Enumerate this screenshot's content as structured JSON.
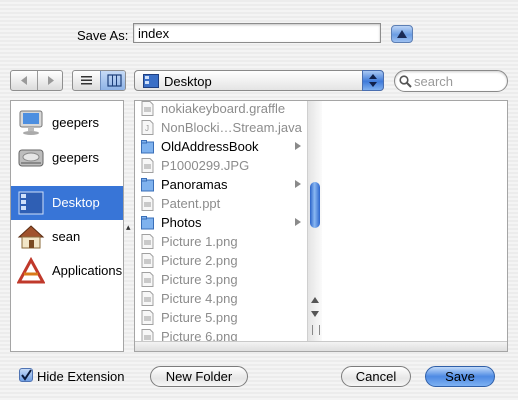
{
  "save_as": {
    "label": "Save As:",
    "filename": "index"
  },
  "toolbar": {
    "location": "Desktop",
    "search_placeholder": "search"
  },
  "sidebar": {
    "items": [
      {
        "label": "geepers",
        "icon": "computer-icon"
      },
      {
        "label": "geepers",
        "icon": "hard-drive-icon"
      },
      {
        "label": "Desktop",
        "icon": "desktop-icon",
        "selected": true
      },
      {
        "label": "sean",
        "icon": "home-icon"
      },
      {
        "label": "Applications",
        "icon": "applications-icon"
      }
    ]
  },
  "browser": {
    "column1": [
      {
        "name": "nokiakeyboard.graffle",
        "kind": "file",
        "enabled": false
      },
      {
        "name": "NonBlocki…Stream.java",
        "kind": "java-file",
        "enabled": false
      },
      {
        "name": "OldAddressBook",
        "kind": "folder",
        "enabled": true
      },
      {
        "name": "P1000299.JPG",
        "kind": "file",
        "enabled": false
      },
      {
        "name": "Panoramas",
        "kind": "folder",
        "enabled": true
      },
      {
        "name": "Patent.ppt",
        "kind": "file",
        "enabled": false
      },
      {
        "name": "Photos",
        "kind": "folder",
        "enabled": true
      },
      {
        "name": "Picture 1.png",
        "kind": "file",
        "enabled": false
      },
      {
        "name": "Picture 2.png",
        "kind": "file",
        "enabled": false
      },
      {
        "name": "Picture 3.png",
        "kind": "file",
        "enabled": false
      },
      {
        "name": "Picture 4.png",
        "kind": "file",
        "enabled": false
      },
      {
        "name": "Picture 5.png",
        "kind": "file",
        "enabled": false
      },
      {
        "name": "Picture 6.png",
        "kind": "file",
        "enabled": false
      }
    ]
  },
  "bottom": {
    "hide_extension_label": "Hide Extension",
    "hide_extension_checked": true,
    "new_folder_label": "New Folder",
    "cancel_label": "Cancel",
    "save_label": "Save"
  },
  "colors": {
    "selection": "#3875d7",
    "accent": "#4e8ae3"
  }
}
